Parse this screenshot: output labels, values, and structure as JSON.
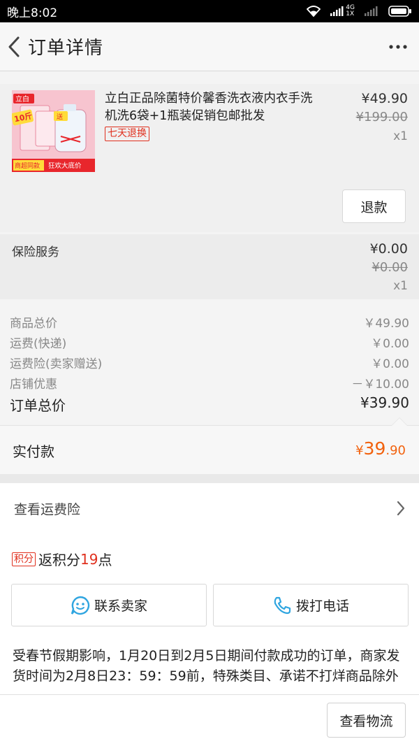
{
  "status_bar": {
    "time": "晚上8:02",
    "network_top": "4G",
    "network_bottom": "1X"
  },
  "header": {
    "title": "订单详情",
    "back_icon": "chevron-left-icon",
    "more_icon": "more-dots-icon"
  },
  "product": {
    "title": "立白正品除菌特价馨香洗衣液内衣手洗机洗6袋+1瓶装促销包邮批发",
    "badge": "七天退换",
    "price": "¥49.90",
    "original_price": "¥199.00",
    "quantity": "x1",
    "refund_label": "退款",
    "image": {
      "brand": "立白",
      "promo_top": "10斤",
      "promo_side": "送",
      "banner_left": "商超同款",
      "banner_right": "狂欢大底价"
    }
  },
  "insurance": {
    "label": "保险服务",
    "price": "¥0.00",
    "original_price": "¥0.00",
    "quantity": "x1"
  },
  "summary": {
    "rows": [
      {
        "label": "商品总价",
        "value": "￥49.90"
      },
      {
        "label": "运费(快递)",
        "value": "￥0.00"
      },
      {
        "label": "运费险(卖家赠送)",
        "value": "￥0.00"
      },
      {
        "label": "店铺优惠",
        "value": "－￥10.00"
      }
    ],
    "total_label": "订单总价",
    "total_value": "¥39.90"
  },
  "paid": {
    "label": "实付款",
    "currency": "¥",
    "integer": "39",
    "decimal": ".90"
  },
  "freight_insurance": {
    "label": "查看运费险"
  },
  "points": {
    "badge": "积分",
    "prefix": "返积分",
    "count": "19",
    "suffix": "点"
  },
  "actions": {
    "contact_seller": "联系卖家",
    "call_phone": "拨打电话"
  },
  "notice": {
    "text": "受春节假期影响，1月20日到2月5日期间付款成功的订单，商家发货时间为2月8日23：59：59前，特殊类目、承诺不打烊商品除外"
  },
  "bottom": {
    "logistics_label": "查看物流"
  },
  "colors": {
    "accent_orange": "#f2620e",
    "badge_red": "#e0301e",
    "chat_icon_blue": "#2fa5e0"
  }
}
